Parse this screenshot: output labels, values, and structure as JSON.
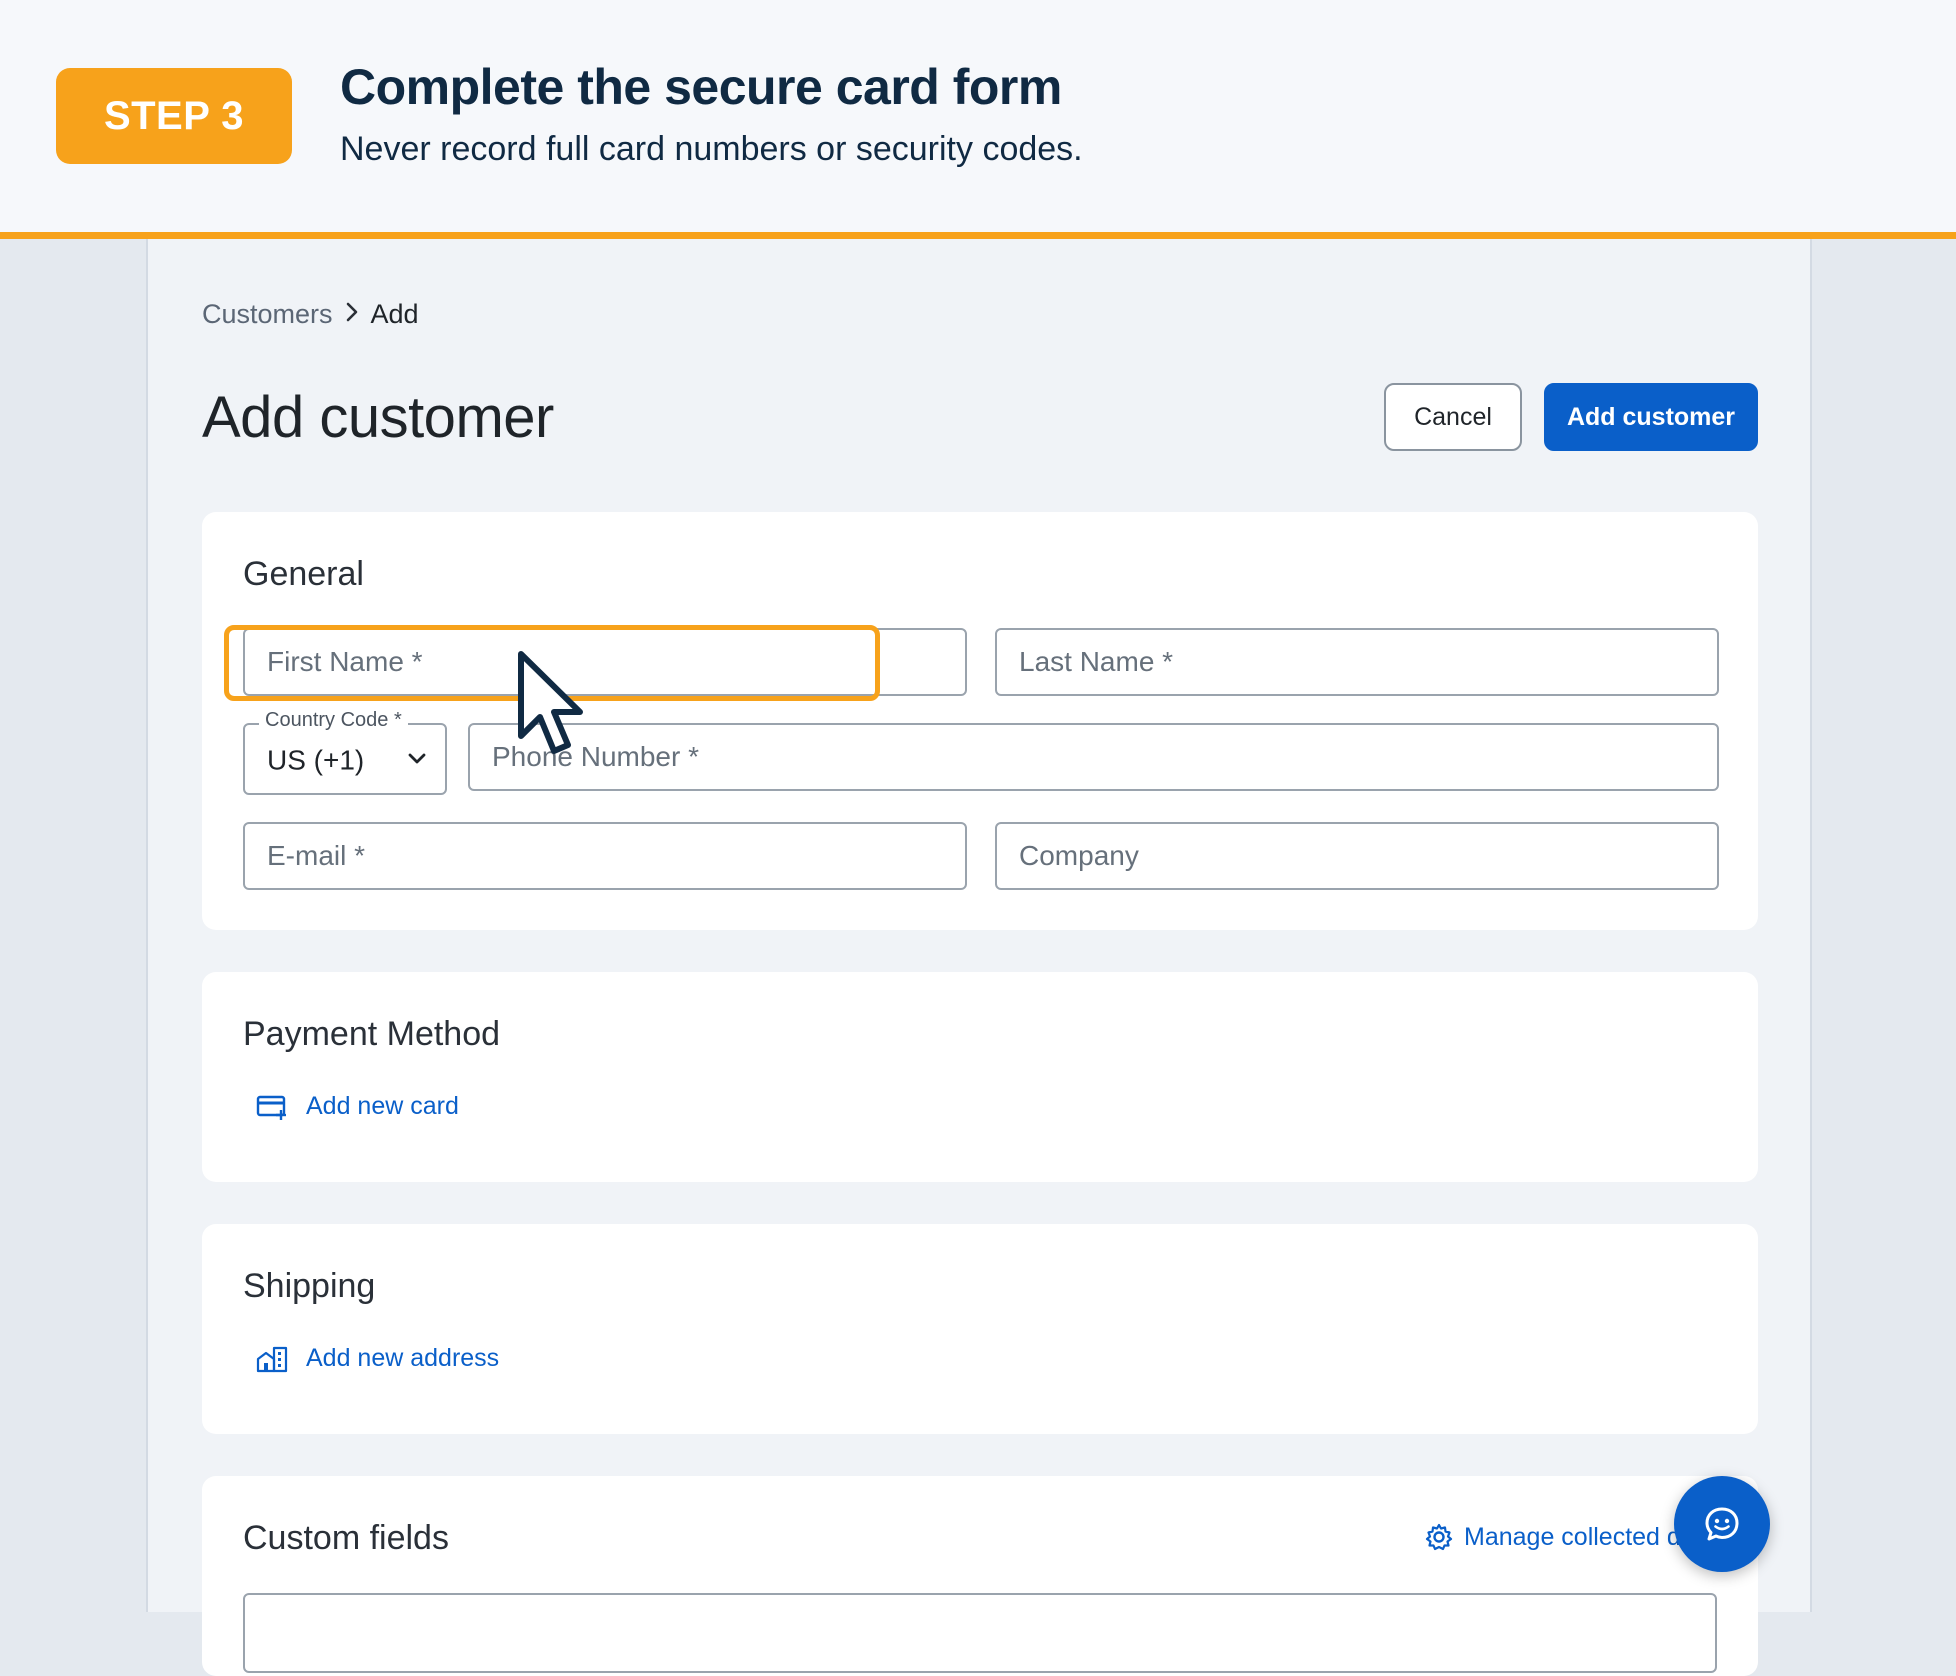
{
  "banner": {
    "step_label": "STEP 3",
    "title": "Complete the secure card form",
    "subtitle": "Never record full card numbers or security codes.",
    "accent_color": "#f7a21b"
  },
  "breadcrumb": {
    "parent": "Customers",
    "current": "Add"
  },
  "page": {
    "title": "Add customer"
  },
  "actions": {
    "cancel_label": "Cancel",
    "submit_label": "Add customer",
    "primary_color": "#0a5fc9"
  },
  "general": {
    "title": "General",
    "first_name_placeholder": "First Name *",
    "last_name_placeholder": "Last Name *",
    "country_code_label": "Country Code *",
    "country_code_value": "US (+1)",
    "phone_placeholder": "Phone Number *",
    "email_placeholder": "E-mail *",
    "company_placeholder": "Company"
  },
  "payment": {
    "title": "Payment Method",
    "add_card_label": "Add new card",
    "icon": "credit-card-plus-icon"
  },
  "shipping": {
    "title": "Shipping",
    "add_address_label": "Add new address",
    "icon": "building-icon"
  },
  "custom_fields": {
    "title": "Custom fields",
    "manage_label": "Manage collected d",
    "icon": "gear-icon"
  },
  "chat": {
    "icon": "chat-bubble-icon"
  }
}
